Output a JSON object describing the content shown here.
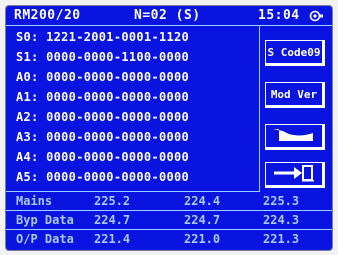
{
  "header": {
    "model": "RM200/20",
    "node": "N=02 (S)",
    "time": "15:04",
    "status_icon": "ups-icon"
  },
  "codes": [
    {
      "label": "S0:",
      "value": "1221-2001-0001-1120"
    },
    {
      "label": "S1:",
      "value": "0000-0000-1100-0000"
    },
    {
      "label": "A0:",
      "value": "0000-0000-0000-0000"
    },
    {
      "label": "A1:",
      "value": "0000-0000-0000-0000"
    },
    {
      "label": "A2:",
      "value": "0000-0000-0000-0000"
    },
    {
      "label": "A3:",
      "value": "0000-0000-0000-0000"
    },
    {
      "label": "A4:",
      "value": "0000-0000-0000-0000"
    },
    {
      "label": "A5:",
      "value": "0000-0000-0000-0000"
    }
  ],
  "buttons": {
    "s_code": "S Code09",
    "mod_ver": "Mod Ver",
    "wave_icon": "waveform-icon",
    "exit_icon": "exit-arrow-icon"
  },
  "readings": [
    {
      "label": "Mains",
      "v1": "225.2",
      "v2": "224.4",
      "v3": "225.3"
    },
    {
      "label": "Byp Data",
      "v1": "224.7",
      "v2": "224.7",
      "v3": "224.3"
    },
    {
      "label": "O/P Data",
      "v1": "221.4",
      "v2": "221.0",
      "v3": "221.3"
    }
  ],
  "colors": {
    "screen_bg": "#0a14e0",
    "text": "#ffffff",
    "grid_line": "#9ad0ff",
    "readings_text": "#a9c8ff"
  }
}
